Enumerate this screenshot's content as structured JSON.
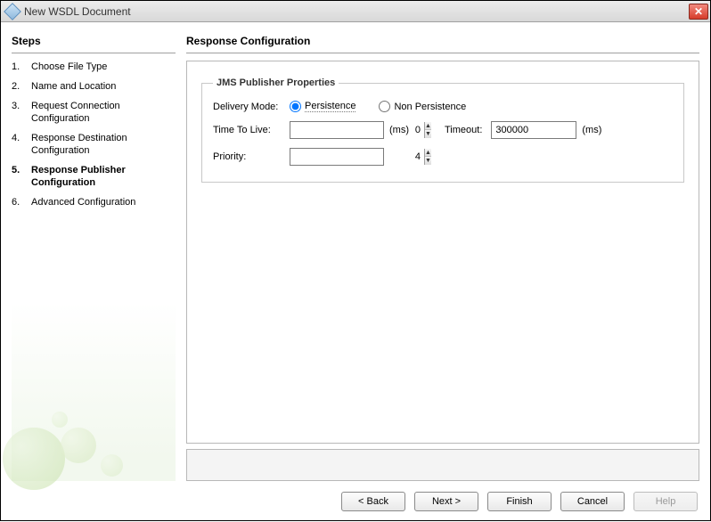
{
  "window": {
    "title": "New WSDL Document"
  },
  "sidebar": {
    "heading": "Steps",
    "steps": [
      {
        "num": "1.",
        "label": "Choose File Type"
      },
      {
        "num": "2.",
        "label": "Name and Location"
      },
      {
        "num": "3.",
        "label": "Request Connection Configuration"
      },
      {
        "num": "4.",
        "label": "Response Destination Configuration"
      },
      {
        "num": "5.",
        "label": "Response Publisher Configuration"
      },
      {
        "num": "6.",
        "label": "Advanced Configuration"
      }
    ],
    "active_index": 4
  },
  "main": {
    "heading": "Response Configuration",
    "group_legend": "JMS Publisher Properties",
    "delivery_mode_label": "Delivery Mode:",
    "delivery_mode_persistence": "Persistence",
    "delivery_mode_non_persistence": "Non Persistence",
    "delivery_mode_selected": "persistence",
    "ttl_label": "Time To Live:",
    "ttl_value": "0",
    "ttl_unit": "(ms)",
    "timeout_label": "Timeout:",
    "timeout_value": "300000",
    "timeout_unit": "(ms)",
    "priority_label": "Priority:",
    "priority_value": "4"
  },
  "buttons": {
    "back": "< Back",
    "next": "Next >",
    "finish": "Finish",
    "cancel": "Cancel",
    "help": "Help"
  }
}
